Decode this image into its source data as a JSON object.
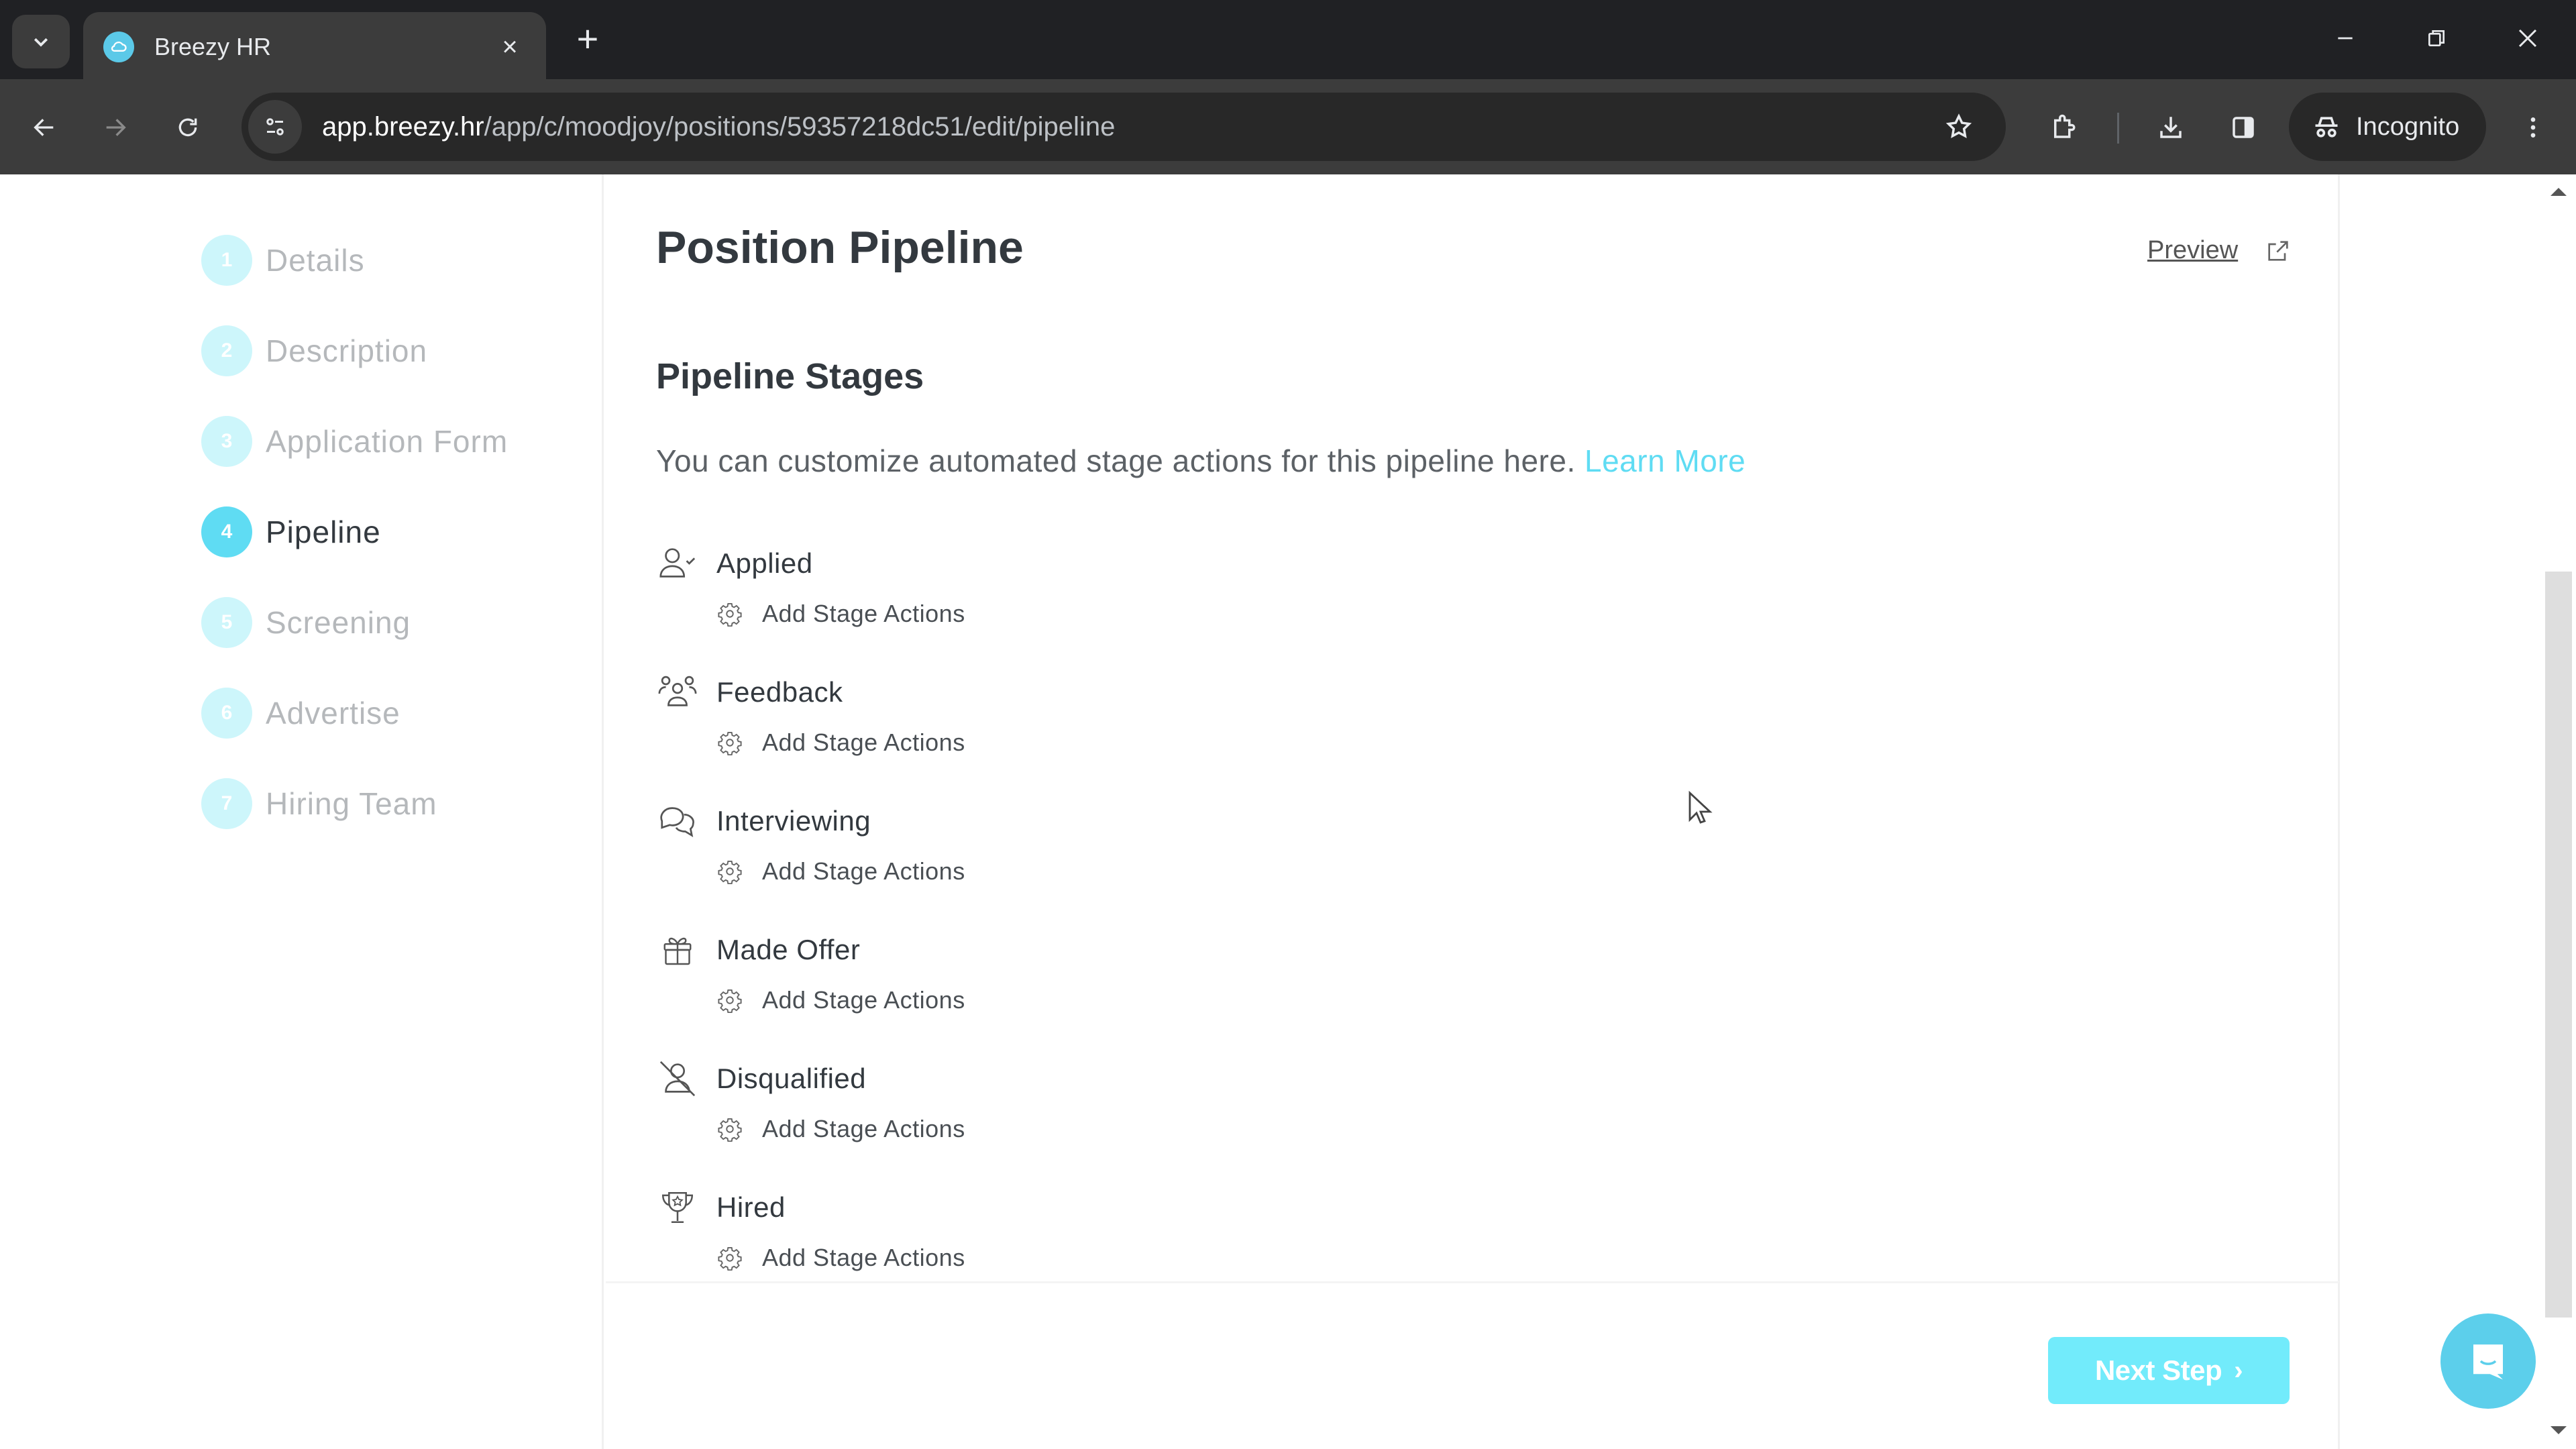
{
  "browser": {
    "tab_title": "Breezy HR",
    "tab_close": "×",
    "new_tab": "+",
    "url_host": "app.breezy.hr",
    "url_path": "/app/c/moodjoy/positions/59357218dc51/edit/pipeline",
    "incognito_label": "Incognito",
    "window_close": "✕"
  },
  "sidebar": {
    "steps": [
      {
        "number": "1",
        "label": "Details",
        "active": false
      },
      {
        "number": "2",
        "label": "Description",
        "active": false
      },
      {
        "number": "3",
        "label": "Application Form",
        "active": false
      },
      {
        "number": "4",
        "label": "Pipeline",
        "active": true
      },
      {
        "number": "5",
        "label": "Screening",
        "active": false
      },
      {
        "number": "6",
        "label": "Advertise",
        "active": false
      },
      {
        "number": "7",
        "label": "Hiring Team",
        "active": false
      }
    ]
  },
  "main": {
    "title": "Position Pipeline",
    "preview_label": "Preview",
    "section_title": "Pipeline Stages",
    "description": "You can customize automated stage actions for this pipeline here.",
    "learn_more": "Learn More",
    "stages": [
      {
        "name": "Applied",
        "icon": "user-check-icon",
        "action": "Add Stage Actions"
      },
      {
        "name": "Feedback",
        "icon": "users-group-icon",
        "action": "Add Stage Actions"
      },
      {
        "name": "Interviewing",
        "icon": "chat-bubbles-icon",
        "action": "Add Stage Actions"
      },
      {
        "name": "Made Offer",
        "icon": "gift-icon",
        "action": "Add Stage Actions"
      },
      {
        "name": "Disqualified",
        "icon": "user-slash-icon",
        "action": "Add Stage Actions"
      },
      {
        "name": "Hired",
        "icon": "trophy-icon",
        "action": "Add Stage Actions"
      }
    ]
  },
  "footer": {
    "next_step_label": "Next Step",
    "next_step_chevron": "›"
  },
  "colors": {
    "accent": "#5fdcf3",
    "accent_light": "#cdf6fb",
    "button": "#72ebfb",
    "chat_widget": "#5ccfeb",
    "text_dark": "#33393f",
    "text_muted": "#b5b8bb"
  }
}
